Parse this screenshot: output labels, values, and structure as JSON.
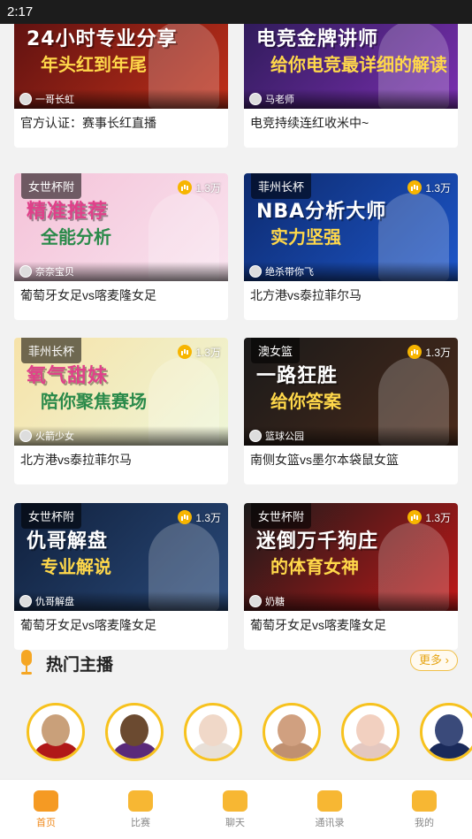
{
  "status_bar": {
    "time": "2:17"
  },
  "cards": [
    {
      "tag": "",
      "heat": "",
      "host": "一哥长虹",
      "title": "官方认证：赛事长红直播",
      "poster_line1": "24小时专业分享",
      "poster_line2": "年头红到年尾",
      "colors": [
        "#5a1010",
        "#c0301a"
      ]
    },
    {
      "tag": "",
      "heat": "",
      "host": "马老师",
      "title": "电竞持续连红收米中~",
      "poster_line1": "电竞金牌讲师",
      "poster_line2": "给你电竞最详细的解读",
      "colors": [
        "#2b1a55",
        "#7a2fb0"
      ]
    },
    {
      "tag": "女世杯附",
      "heat": "1.3万",
      "host": "奈奈宝贝",
      "title": "葡萄牙女足vs喀麦隆女足",
      "poster_line1": "精准推荐",
      "poster_line2": "全能分析",
      "colors": [
        "#f4c2d8",
        "#f9e4ef"
      ]
    },
    {
      "tag": "菲州长杯",
      "heat": "1.3万",
      "host": "绝杀带你飞",
      "title": "北方港vs泰拉菲尔马",
      "poster_line1": "NBA分析大师",
      "poster_line2": "实力坚强",
      "colors": [
        "#0d2a6e",
        "#1d56c9"
      ]
    },
    {
      "tag": "菲州长杯",
      "heat": "1.3万",
      "host": "火箭少女",
      "title": "北方港vs泰拉菲尔马",
      "poster_line1": "氧气甜妹",
      "poster_line2": "陪你聚焦赛场",
      "colors": [
        "#f6e2a8",
        "#eef6d8"
      ]
    },
    {
      "tag": "澳女篮",
      "heat": "1.3万",
      "host": "篮球公园",
      "title": "南侧女篮vs墨尔本袋鼠女篮",
      "poster_line1": "一路狂胜",
      "poster_line2": "给你答案",
      "colors": [
        "#1a1a1a",
        "#4a2a1a"
      ]
    },
    {
      "tag": "女世杯附",
      "heat": "1.3万",
      "host": "仇哥解盘",
      "title": "葡萄牙女足vs喀麦隆女足",
      "poster_line1": "仇哥解盘",
      "poster_line2": "专业解说",
      "colors": [
        "#10203c",
        "#2a4a7a"
      ]
    },
    {
      "tag": "女世杯附",
      "heat": "1.3万",
      "host": "奶糖",
      "title": "葡萄牙女足vs喀麦隆女足",
      "poster_line1": "迷倒万千狗庄",
      "poster_line2": "的体育女神",
      "colors": [
        "#1a1a1a",
        "#c01818"
      ]
    }
  ],
  "hot_hosts": {
    "title": "热门主播",
    "more": "更多",
    "avatars": [
      {
        "face": "#c9a07a",
        "body": "#b01818"
      },
      {
        "face": "#6b4a30",
        "body": "#5a2a7a"
      },
      {
        "face": "#f0d8c8",
        "body": "#e8e0d8"
      },
      {
        "face": "#d0a080",
        "body": "#c09070"
      },
      {
        "face": "#f2d0c0",
        "body": "#e4c8c0"
      },
      {
        "face": "#3a4a7a",
        "body": "#1a2a5a"
      }
    ]
  },
  "tabbar": [
    {
      "label": "首页",
      "icon": "home-icon",
      "color": "#f59a23",
      "active": true
    },
    {
      "label": "比赛",
      "icon": "match-icon",
      "color": "#f7b733",
      "active": false
    },
    {
      "label": "聊天",
      "icon": "chat-icon",
      "color": "#f7b733",
      "active": false
    },
    {
      "label": "通讯录",
      "icon": "contacts-icon",
      "color": "#f7b733",
      "active": false
    },
    {
      "label": "我的",
      "icon": "profile-icon",
      "color": "#f7b733",
      "active": false
    }
  ]
}
